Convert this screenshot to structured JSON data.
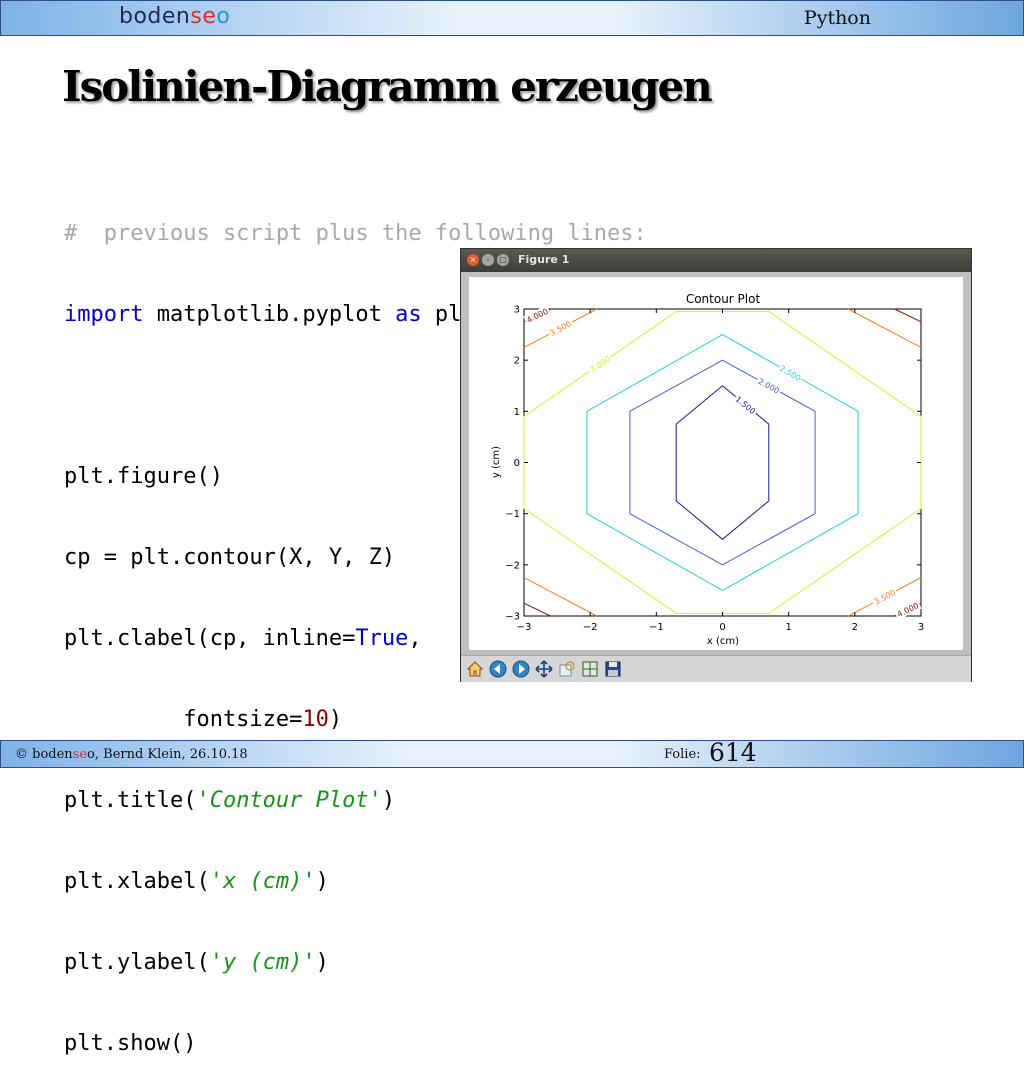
{
  "header": {
    "logo_parts": [
      "boden",
      "se",
      "o"
    ],
    "section": "Python"
  },
  "slide": {
    "title": "Isolinien-Diagramm erzeugen"
  },
  "code": {
    "comment": "#  previous script plus the following lines:",
    "import_kw": "import",
    "import_mod": " matplotlib.pyplot ",
    "as_kw": "as",
    "import_alias": " plt",
    "figure": "plt.figure()",
    "contour": "cp = plt.contour(X, Y, Z)",
    "clabel_a": "plt.clabel(cp, inline=",
    "clabel_true": "True",
    "clabel_b": ",",
    "fontsize_a": "         fontsize=",
    "fontsize_num": "10",
    "fontsize_b": ")",
    "title_a": "plt.title(",
    "title_str": "'Contour Plot'",
    "title_b": ")",
    "xlabel_a": "plt.xlabel(",
    "xlabel_str": "'x (cm)'",
    "xlabel_b": ")",
    "ylabel_a": "plt.ylabel(",
    "ylabel_str": "'y (cm)'",
    "ylabel_b": ")",
    "show": "plt.show()"
  },
  "figure_window": {
    "title": "Figure 1",
    "toolbar_icons": [
      "home-icon",
      "back-icon",
      "forward-icon",
      "pan-icon",
      "zoom-icon",
      "subplots-icon",
      "save-icon"
    ]
  },
  "chart_data": {
    "type": "contour",
    "title": "Contour Plot",
    "xlabel": "x (cm)",
    "ylabel": "y (cm)",
    "xlim": [
      -3,
      3
    ],
    "ylim": [
      -3,
      3
    ],
    "xticks": [
      "−3",
      "−2",
      "−1",
      "0",
      "1",
      "2",
      "3"
    ],
    "yticks": [
      "−3",
      "−2",
      "−1",
      "0",
      "1",
      "2",
      "3"
    ],
    "levels": [
      {
        "level": 1.5,
        "label": "1.500",
        "color": "#1a1a9c",
        "points": [
          [
            0,
            1.5
          ],
          [
            0.7,
            0.75
          ],
          [
            0.7,
            -0.75
          ],
          [
            0,
            -1.5
          ],
          [
            -0.7,
            -0.75
          ],
          [
            -0.7,
            0.75
          ]
        ]
      },
      {
        "level": 2.0,
        "label": "2.000",
        "color": "#3f5fdc",
        "points": [
          [
            0,
            2.0
          ],
          [
            1.4,
            1.0
          ],
          [
            1.4,
            -1.0
          ],
          [
            0,
            -2.0
          ],
          [
            -1.4,
            -1.0
          ],
          [
            -1.4,
            1.0
          ]
        ]
      },
      {
        "level": 2.5,
        "label": "2.500",
        "color": "#25d0d6",
        "points": [
          [
            0,
            2.5
          ],
          [
            2.05,
            1.0
          ],
          [
            2.05,
            -1.0
          ],
          [
            0,
            -2.5
          ],
          [
            -2.05,
            -1.0
          ],
          [
            -2.05,
            1.0
          ]
        ]
      },
      {
        "level": 3.0,
        "label": "3.000",
        "color": "#d6ee26",
        "points": [
          [
            -3.0,
            0.9
          ],
          [
            -0.7,
            2.95
          ],
          [
            0.7,
            2.95
          ],
          [
            3.0,
            0.9
          ],
          [
            3.0,
            -0.9
          ],
          [
            0.7,
            -2.95
          ],
          [
            -0.7,
            -2.95
          ],
          [
            -3.0,
            -0.9
          ]
        ]
      },
      {
        "level": 3.5,
        "label": "3.500",
        "color": "#ff7a1e",
        "points": [
          [
            -3.0,
            2.25
          ],
          [
            -1.9,
            3.0
          ]
        ]
      },
      {
        "level": 3.5,
        "label": "",
        "color": "#ff7a1e",
        "points": [
          [
            1.9,
            3.0
          ],
          [
            3.0,
            2.25
          ]
        ]
      },
      {
        "level": 3.5,
        "label": "",
        "color": "#ff7a1e",
        "points": [
          [
            -3.0,
            -2.25
          ],
          [
            -1.9,
            -3.0
          ]
        ]
      },
      {
        "level": 3.5,
        "label": "3.500",
        "color": "#ff7a1e",
        "points": [
          [
            1.9,
            -3.0
          ],
          [
            3.0,
            -2.25
          ]
        ]
      },
      {
        "level": 4.0,
        "label": "4.000",
        "color": "#8b1a10",
        "points": [
          [
            -3.0,
            2.75
          ],
          [
            -2.6,
            3.0
          ]
        ]
      },
      {
        "level": 4.0,
        "label": "",
        "color": "#8b1a10",
        "points": [
          [
            2.6,
            3.0
          ],
          [
            3.0,
            2.75
          ]
        ]
      },
      {
        "level": 4.0,
        "label": "",
        "color": "#8b1a10",
        "points": [
          [
            -3.0,
            -2.75
          ],
          [
            -2.6,
            -3.0
          ]
        ]
      },
      {
        "level": 4.0,
        "label": "4.000",
        "color": "#8b1a10",
        "points": [
          [
            2.6,
            -3.0
          ],
          [
            3.0,
            -2.75
          ]
        ]
      }
    ]
  },
  "footer": {
    "copyright_a": "© boden",
    "copyright_hl": "se",
    "copyright_b": "o, Bernd Klein, 26.10.18",
    "folie_label": "Folie:",
    "page_number": "614"
  }
}
